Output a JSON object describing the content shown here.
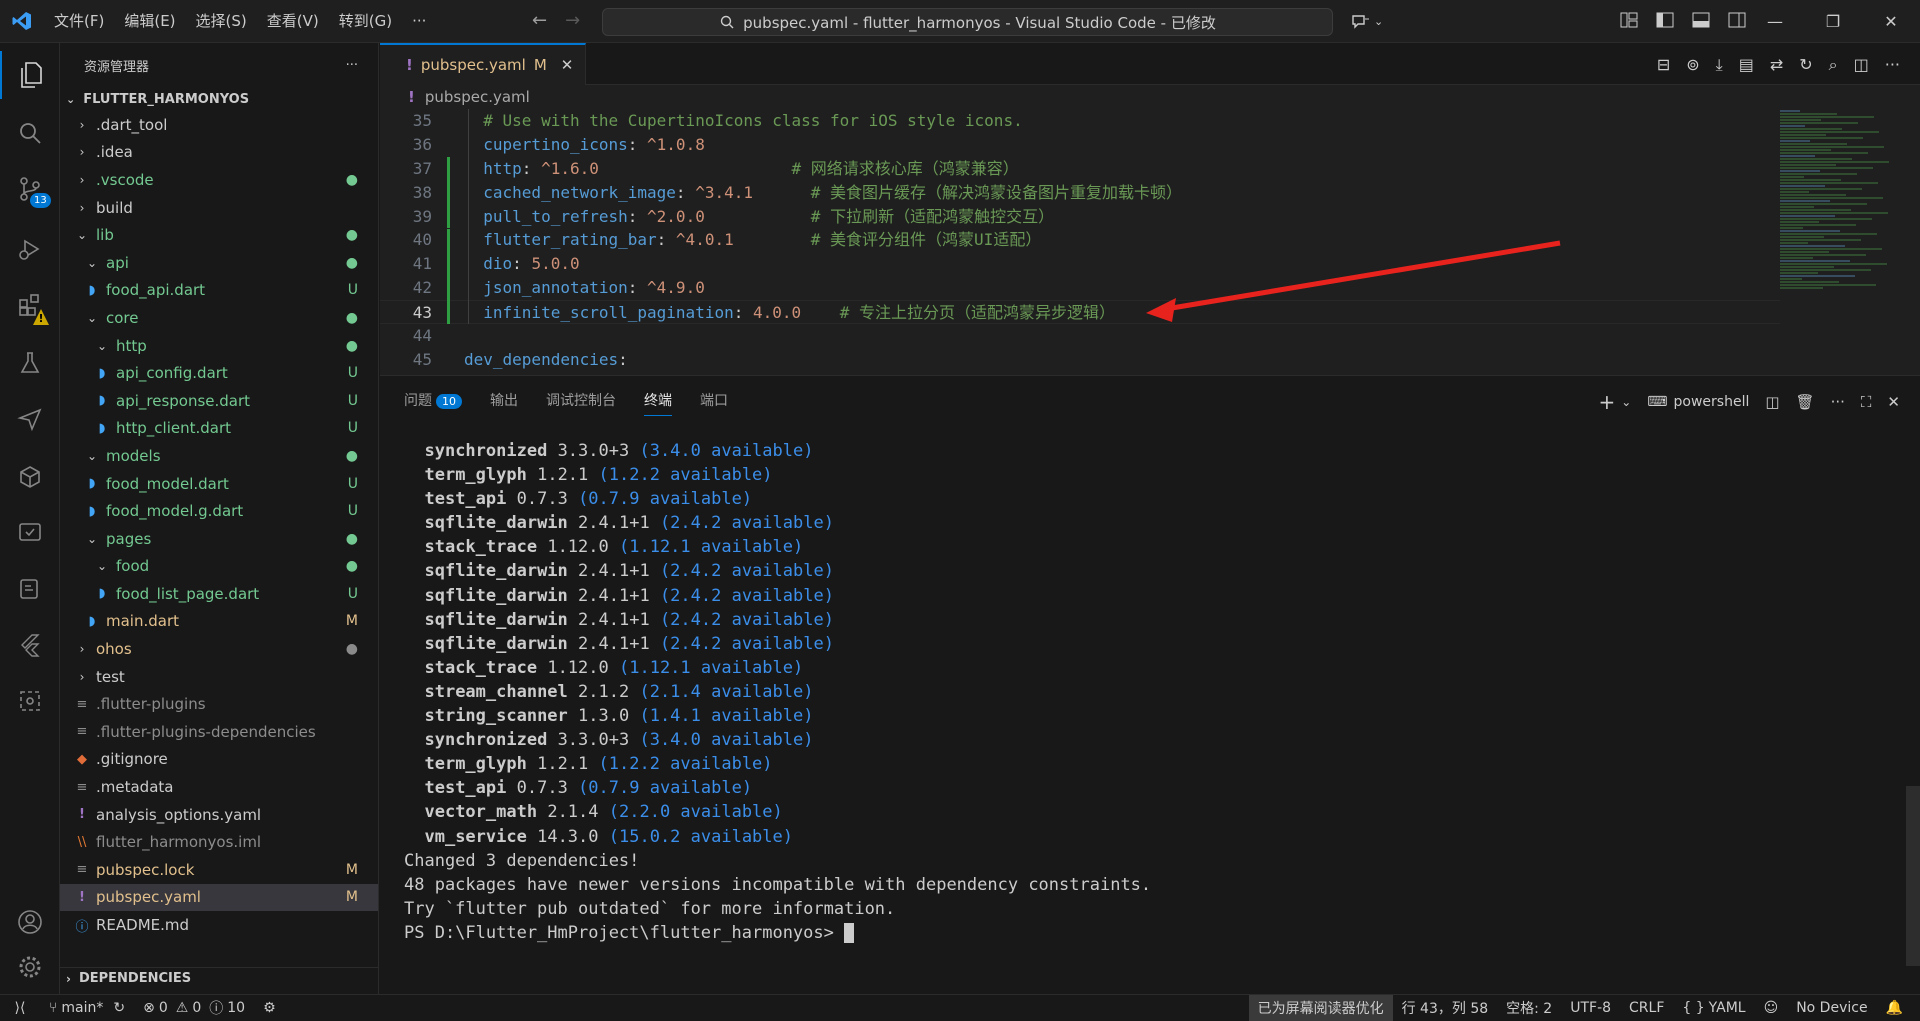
{
  "titlebar": {
    "menus": [
      "文件(F)",
      "编辑(E)",
      "选择(S)",
      "查看(V)",
      "转到(G)",
      "···"
    ],
    "search_text": "pubspec.yaml - flutter_harmonyos - Visual Studio Code - 已修改",
    "win_minimize": "—",
    "win_restore": "❐",
    "win_close": "✕"
  },
  "activitybar": {
    "scm_badge": "13"
  },
  "sidebar": {
    "title": "资源管理器",
    "more": "···",
    "root": "FLUTTER_HARMONYOS",
    "items": [
      {
        "label": ".dart_tool",
        "depth": 0,
        "type": "folder",
        "open": false,
        "status": "",
        "color": "normal"
      },
      {
        "label": ".idea",
        "depth": 0,
        "type": "folder",
        "open": false,
        "status": "",
        "color": "normal"
      },
      {
        "label": ".vscode",
        "depth": 0,
        "type": "folder",
        "open": false,
        "status": "dot",
        "color": "untracked"
      },
      {
        "label": "build",
        "depth": 0,
        "type": "folder",
        "open": false,
        "status": "",
        "color": "normal"
      },
      {
        "label": "lib",
        "depth": 0,
        "type": "folder",
        "open": true,
        "status": "dot",
        "color": "untracked"
      },
      {
        "label": "api",
        "depth": 1,
        "type": "folder",
        "open": true,
        "status": "dot",
        "color": "untracked"
      },
      {
        "label": "food_api.dart",
        "depth": 1,
        "type": "dart",
        "open": false,
        "status": "U",
        "color": "untracked"
      },
      {
        "label": "core",
        "depth": 1,
        "type": "folder",
        "open": true,
        "status": "dot",
        "color": "untracked"
      },
      {
        "label": "http",
        "depth": 2,
        "type": "folder",
        "open": true,
        "status": "dot",
        "color": "untracked"
      },
      {
        "label": "api_config.dart",
        "depth": 2,
        "type": "dart",
        "open": false,
        "status": "U",
        "color": "untracked"
      },
      {
        "label": "api_response.dart",
        "depth": 2,
        "type": "dart",
        "open": false,
        "status": "U",
        "color": "untracked"
      },
      {
        "label": "http_client.dart",
        "depth": 2,
        "type": "dart",
        "open": false,
        "status": "U",
        "color": "untracked"
      },
      {
        "label": "models",
        "depth": 1,
        "type": "folder",
        "open": true,
        "status": "dot",
        "color": "untracked"
      },
      {
        "label": "food_model.dart",
        "depth": 1,
        "type": "dart",
        "open": false,
        "status": "U",
        "color": "untracked"
      },
      {
        "label": "food_model.g.dart",
        "depth": 1,
        "type": "dart",
        "open": false,
        "status": "U",
        "color": "untracked"
      },
      {
        "label": "pages",
        "depth": 1,
        "type": "folder",
        "open": true,
        "status": "dot",
        "color": "untracked"
      },
      {
        "label": "food",
        "depth": 2,
        "type": "folder",
        "open": true,
        "status": "dot",
        "color": "untracked"
      },
      {
        "label": "food_list_page.dart",
        "depth": 2,
        "type": "dart",
        "open": false,
        "status": "U",
        "color": "untracked"
      },
      {
        "label": "main.dart",
        "depth": 0,
        "type": "dart",
        "open": false,
        "status": "M",
        "color": "modified"
      },
      {
        "label": "ohos",
        "depth": 0,
        "type": "folder",
        "open": false,
        "status": "dotgray",
        "color": "modified"
      },
      {
        "label": "test",
        "depth": 0,
        "type": "folder",
        "open": false,
        "status": "",
        "color": "normal"
      },
      {
        "label": ".flutter-plugins",
        "depth": 0,
        "type": "lines",
        "open": false,
        "status": "",
        "color": "dim"
      },
      {
        "label": ".flutter-plugins-dependencies",
        "depth": 0,
        "type": "lines",
        "open": false,
        "status": "",
        "color": "dim"
      },
      {
        "label": ".gitignore",
        "depth": 0,
        "type": "git",
        "open": false,
        "status": "",
        "color": "normal"
      },
      {
        "label": ".metadata",
        "depth": 0,
        "type": "lines",
        "open": false,
        "status": "",
        "color": "normal"
      },
      {
        "label": "analysis_options.yaml",
        "depth": 0,
        "type": "yaml",
        "open": false,
        "status": "",
        "color": "normal"
      },
      {
        "label": "flutter_harmonyos.iml",
        "depth": 0,
        "type": "rss",
        "open": false,
        "status": "",
        "color": "dim"
      },
      {
        "label": "pubspec.lock",
        "depth": 0,
        "type": "lines",
        "open": false,
        "status": "M",
        "color": "modified"
      },
      {
        "label": "pubspec.yaml",
        "depth": 0,
        "type": "yaml",
        "open": false,
        "status": "M",
        "color": "modified",
        "selected": true
      },
      {
        "label": "README.md",
        "depth": 0,
        "type": "info",
        "open": false,
        "status": "",
        "color": "normal"
      }
    ],
    "dependencies": "DEPENDENCIES"
  },
  "editor": {
    "tab_label": "pubspec.yaml",
    "tab_status": "M",
    "tab_icon": "!",
    "breadcrumb": "pubspec.yaml",
    "lines": [
      {
        "num": "35",
        "key": "",
        "sep": "",
        "val": "",
        "comment": "# Use with the CupertinoIcons class for iOS style icons.",
        "indent": "  ",
        "git": false
      },
      {
        "num": "36",
        "key": "cupertino_icons",
        "sep": ": ",
        "val": "^1.0.8",
        "comment": "",
        "indent": "  ",
        "git": false
      },
      {
        "num": "37",
        "key": "http",
        "sep": ": ",
        "val": "^1.6.0",
        "pad": "                    ",
        "comment": "# 网络请求核心库（鸿蒙兼容）",
        "indent": "  ",
        "git": true
      },
      {
        "num": "38",
        "key": "cached_network_image",
        "sep": ": ",
        "val": "^3.4.1",
        "pad": "      ",
        "comment": "# 美食图片缓存（解决鸿蒙设备图片重复加载卡顿）",
        "indent": "  ",
        "git": true
      },
      {
        "num": "39",
        "key": "pull_to_refresh",
        "sep": ": ",
        "val": "^2.0.0",
        "pad": "           ",
        "comment": "# 下拉刷新（适配鸿蒙触控交互）",
        "indent": "  ",
        "git": true
      },
      {
        "num": "40",
        "key": "flutter_rating_bar",
        "sep": ": ",
        "val": "^4.0.1",
        "pad": "        ",
        "comment": "# 美食评分组件（鸿蒙UI适配）",
        "indent": "  ",
        "git": true
      },
      {
        "num": "41",
        "key": "dio",
        "sep": ": ",
        "val": "5.0.0",
        "comment": "",
        "indent": "  ",
        "git": true
      },
      {
        "num": "42",
        "key": "json_annotation",
        "sep": ": ",
        "val": "^4.9.0",
        "comment": "",
        "indent": "  ",
        "git": true
      },
      {
        "num": "43",
        "key": "infinite_scroll_pagination",
        "sep": ": ",
        "val": "4.0.0",
        "pad": "    ",
        "comment": "# 专注上拉分页（适配鸿蒙异步逻辑）",
        "indent": "  ",
        "git": true,
        "current": true
      },
      {
        "num": "44",
        "key": "",
        "sep": "",
        "val": "",
        "comment": "",
        "indent": "",
        "git": false
      },
      {
        "num": "45",
        "key": "dev_dependencies",
        "sep": ":",
        "val": "",
        "comment": "",
        "indent": "",
        "git": false
      }
    ]
  },
  "panel": {
    "tabs": [
      {
        "label": "问题",
        "count": "10"
      },
      {
        "label": "输出",
        "count": ""
      },
      {
        "label": "调试控制台",
        "count": ""
      },
      {
        "label": "终端",
        "count": "",
        "active": true
      },
      {
        "label": "端口",
        "count": ""
      }
    ],
    "shell": "powershell",
    "terminal_lines": [
      {
        "indent": "  ",
        "pkg": "synchronized",
        "ver": "3.3.0+3",
        "avail": "(3.4.0 available)"
      },
      {
        "indent": "  ",
        "pkg": "term_glyph",
        "ver": "1.2.1",
        "avail": "(1.2.2 available)"
      },
      {
        "indent": "  ",
        "pkg": "test_api",
        "ver": "0.7.3",
        "avail": "(0.7.9 available)"
      },
      {
        "indent": "  ",
        "pkg": "sqflite_darwin",
        "ver": "2.4.1+1",
        "avail": "(2.4.2 available)"
      },
      {
        "indent": "  ",
        "pkg": "stack_trace",
        "ver": "1.12.0",
        "avail": "(1.12.1 available)"
      },
      {
        "indent": "  ",
        "pkg": "sqflite_darwin",
        "ver": "2.4.1+1",
        "avail": "(2.4.2 available)"
      },
      {
        "indent": "  ",
        "pkg": "sqflite_darwin",
        "ver": "2.4.1+1",
        "avail": "(2.4.2 available)"
      },
      {
        "indent": "  ",
        "pkg": "sqflite_darwin",
        "ver": "2.4.1+1",
        "avail": "(2.4.2 available)"
      },
      {
        "indent": "  ",
        "pkg": "sqflite_darwin",
        "ver": "2.4.1+1",
        "avail": "(2.4.2 available)"
      },
      {
        "indent": "  ",
        "pkg": "stack_trace",
        "ver": "1.12.0",
        "avail": "(1.12.1 available)"
      },
      {
        "indent": "  ",
        "pkg": "stream_channel",
        "ver": "2.1.2",
        "avail": "(2.1.4 available)"
      },
      {
        "indent": "  ",
        "pkg": "string_scanner",
        "ver": "1.3.0",
        "avail": "(1.4.1 available)"
      },
      {
        "indent": "  ",
        "pkg": "synchronized",
        "ver": "3.3.0+3",
        "avail": "(3.4.0 available)"
      },
      {
        "indent": "  ",
        "pkg": "term_glyph",
        "ver": "1.2.1",
        "avail": "(1.2.2 available)"
      },
      {
        "indent": "  ",
        "pkg": "test_api",
        "ver": "0.7.3",
        "avail": "(0.7.9 available)"
      },
      {
        "indent": "  ",
        "pkg": "vector_math",
        "ver": "2.1.4",
        "avail": "(2.2.0 available)"
      },
      {
        "indent": "  ",
        "pkg": "vm_service",
        "ver": "14.3.0",
        "avail": "(15.0.2 available)"
      }
    ],
    "summary_lines": [
      "Changed 3 dependencies!",
      "48 packages have newer versions incompatible with dependency constraints.",
      "Try `flutter pub outdated` for more information."
    ],
    "prompt": "PS D:\\Flutter_HmProject\\flutter_harmonyos> "
  },
  "statusbar": {
    "branch": "main*",
    "errors": "0",
    "warnings": "0",
    "infos": "10",
    "screen_reader": "已为屏幕阅读器优化",
    "position": "行 43，列 58",
    "spaces": "空格: 2",
    "encoding": "UTF-8",
    "eol": "CRLF",
    "language": "YAML",
    "device": "No Device"
  },
  "colors": {
    "accent": "#0078d4",
    "untracked": "#73c991",
    "modified": "#e2c08d",
    "annotation_arrow": "#e8231e"
  }
}
